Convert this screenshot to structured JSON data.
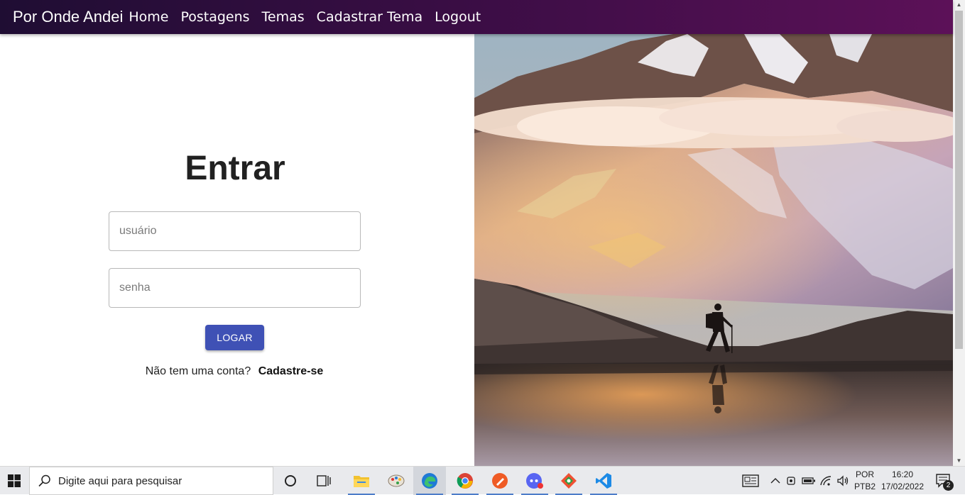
{
  "navbar": {
    "brand": "Por Onde Andei",
    "items": [
      "Home",
      "Postagens",
      "Temas",
      "Cadastrar Tema",
      "Logout"
    ]
  },
  "login": {
    "title": "Entrar",
    "username_placeholder": "usuário",
    "password_placeholder": "senha",
    "button_label": "LOGAR",
    "signup_prompt": "Não tem uma conta?",
    "signup_link": "Cadastre-se"
  },
  "taskbar": {
    "search_placeholder": "Digite aqui para pesquisar",
    "lang_top": "POR",
    "lang_bottom": "PTB2",
    "time": "16:20",
    "date": "17/02/2022",
    "notification_count": "2"
  },
  "colors": {
    "navbar_start": "#1f0d33",
    "navbar_end": "#5c1158",
    "button": "#3f51b5"
  }
}
